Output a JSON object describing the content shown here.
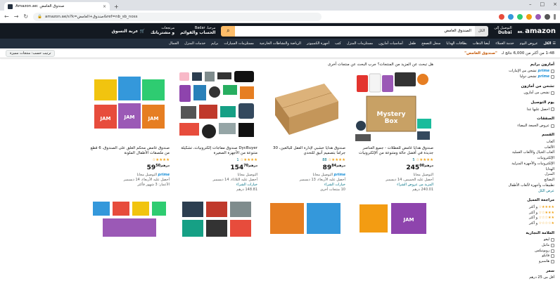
{
  "browser": {
    "tab_title": "Amazon.ae: صندوق الغامض",
    "url": "amazon.ae/s?k=صندوق+الغامض&ref=nb_sb_noss"
  },
  "amazon": {
    "logo": "amazon",
    "logo_suffix": ".ae",
    "deliver_line1": "Dubai",
    "deliver_line2": "التوصيل إلى",
    "search_category": "الكل",
    "search_value": "الصندوق الغامض",
    "account_line1": "مرحبا، Badar",
    "account_line2": "الحساب والقوائم",
    "orders_line1": "مرتجعات",
    "orders_line2": "و مشترياتك",
    "cart_label": "عربة التسوق"
  },
  "nav": {
    "all": "الكل",
    "items": [
      "عروض اليوم",
      "خدمة العملاء",
      "أيضا الذهاب",
      "بطاقات الهدايا",
      "سجل التصفح",
      "طفل",
      "أساسيات أمازون",
      "مستلزمات المنزل",
      "كتب",
      "أجهزة الكمبيوتر",
      "الرياضة والنشاطات الخارجية",
      "مستلزمات السيارات",
      "برايم",
      "خدمات المنزل",
      "الجمال"
    ]
  },
  "results": {
    "summary": "1-48 من أكثر من 6,000 نتائج لـ",
    "query": "\"صندوق الغامض\"",
    "sort_label": "ترتيب حسب: منتجات مميزة"
  },
  "sidebar": {
    "prime_title": "أمازون برايم",
    "prime_options": [
      "تشحن من الإمارات",
      "تشحن دوليا"
    ],
    "fulfilled_title": "تشحن من أمازون",
    "fulfilled_option": "تشحن من أمازون",
    "delivery_title": "يوم التوصيل",
    "delivery_option": "احصل عليها غدا",
    "deals_title": "الصفقات",
    "deals_option": "عروض الجمعة البيضاء",
    "dept_title": "القسم",
    "departments": [
      "ألعاب",
      "الألعاب",
      "ألعاب الخيال والألعاب العملية",
      "الإلكترونيات",
      "الإلكترونيات والأجهزة المنزلية",
      "الهدايا",
      "المنزل",
      "البضائع",
      "تطبيقات وأجهزة لألعاب الأطفال",
      "عرض الكل"
    ],
    "rating_title": "مراجعة العميل",
    "ratings": [
      "و أكثر",
      "و أكثر",
      "و أكثر",
      "و أكثر"
    ],
    "brand_title": "العلامة التجارية",
    "brands": [
      "ليغو",
      "ماتيل",
      "روبوتيكس",
      "فانكو",
      "هاسبرو"
    ],
    "price_title": "سعر",
    "price_option": "أقل من 25 درهم"
  },
  "grid": {
    "hint": "هل تبحث عن المزيد من المنتجات؟ جرب البحث عن منتجات أخرى",
    "products": [
      {
        "title": "صندوق هدايا غامض للعطلات - جميع العناصر جديدة في أفضل حالة ومتنوعة من الإلكترونيات",
        "rating": "★★★★☆",
        "count": "5",
        "price": "245",
        "price_frac": "00",
        "currency": "درهم",
        "line1": "التوصيل مجانا",
        "line2": "أحصل عليه الخميس، 14 ديسمبر",
        "line3": "المزيد من عروض الشراء",
        "line4": "240.01 درهم"
      },
      {
        "title": "صندوق هدايا خشبي لإدارة العقل للبالغين، 30 جراما بتصميم أنيق للتحدي",
        "rating": "★★★★☆",
        "count": "88",
        "price": "89",
        "price_frac": "84",
        "currency": "درهم",
        "line1": "التوصيل مجانا",
        "line2": "أحصل عليه الأربعاء، 13 ديسمبر",
        "line3": "خيارات الشراء",
        "line4": "10 منتجات أخرى"
      },
      {
        "title": "DycBuyer صندوق مفاجآت إلكترونيات، تشكيلة متنوعة من الأجهزة الصغيرة",
        "rating": "★★★★☆",
        "count": "1",
        "price": "154",
        "price_frac": "70",
        "currency": "درهم",
        "line1": "التوصيل مجانا",
        "line2": "أحصل عليه الثلاثاء، 14 ديسمبر",
        "line3": "خيارات الشراء",
        "line4": "148.81 درهم"
      },
      {
        "title": "صندوق غامض محكم الغلق على الصندوق، 6 قطع من ملصقات الأطفال الملونة",
        "rating": "★★★★☆",
        "count": "",
        "price": "59",
        "price_frac": "50",
        "currency": "درهم",
        "line1": "التوصيل مجانا",
        "line2": "أحصل عليه الأربعاء، 14 ديسمبر",
        "line3": "الأعمار: 3 شهور فأكثر",
        "line4": ""
      }
    ]
  },
  "colors": {
    "header_bg": "#131921",
    "nav_bg": "#232f3e",
    "search_button": "#febd69",
    "star": "#f0a41b",
    "link": "#007185",
    "prime": "#1a8fd7"
  }
}
